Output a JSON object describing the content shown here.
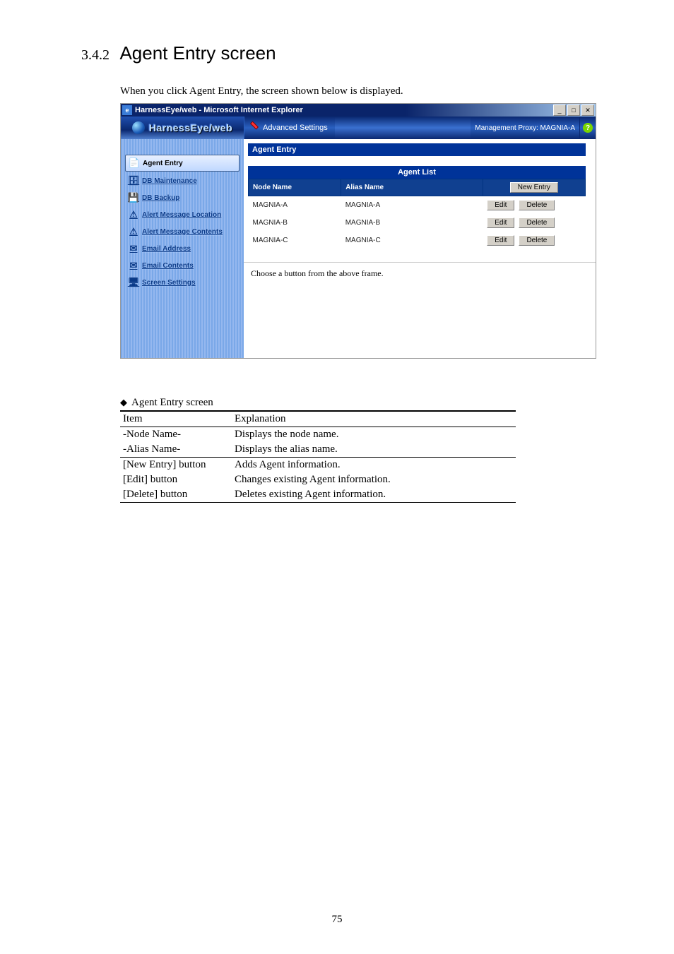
{
  "heading": {
    "number": "3.4.2",
    "title": "Agent Entry screen"
  },
  "intro": "When you click Agent Entry, the screen shown below is displayed.",
  "window": {
    "title": "HarnessEye/web - Microsoft Internet Explorer",
    "brand": "HarnessEye/web",
    "menu_advanced": "Advanced Settings",
    "mgmt_proxy": "Management Proxy: MAGNIA-A",
    "help": "?"
  },
  "sidebar": {
    "items": [
      {
        "label": "Agent Entry",
        "active": true,
        "icon": "📄"
      },
      {
        "label": "DB Maintenance",
        "active": false,
        "icon": "🗄"
      },
      {
        "label": "DB Backup",
        "active": false,
        "icon": "💾"
      },
      {
        "label": "Alert Message Location",
        "active": false,
        "icon": "⚠"
      },
      {
        "label": "Alert Message Contents",
        "active": false,
        "icon": "⚠"
      },
      {
        "label": "Email Address",
        "active": false,
        "icon": "✉"
      },
      {
        "label": "Email Contents",
        "active": false,
        "icon": "✉"
      },
      {
        "label": "Screen Settings",
        "active": false,
        "icon": "🖥"
      }
    ]
  },
  "panel": {
    "title": "Agent Entry",
    "list_title": "Agent List",
    "columns": {
      "node": "Node Name",
      "alias": "Alias Name"
    },
    "new_entry_label": "New Entry",
    "edit_label": "Edit",
    "delete_label": "Delete",
    "rows": [
      {
        "node": "MAGNIA-A",
        "alias": "MAGNIA-A"
      },
      {
        "node": "MAGNIA-B",
        "alias": "MAGNIA-B"
      },
      {
        "node": "MAGNIA-C",
        "alias": "MAGNIA-C"
      }
    ],
    "footer_hint": "Choose a button from the above frame."
  },
  "explain": {
    "caption": "Agent Entry screen",
    "header": {
      "item": "Item",
      "explanation": "Explanation"
    },
    "rows": [
      {
        "item": "-Node Name-",
        "explanation": "Displays the node name."
      },
      {
        "item": "-Alias Name-",
        "explanation": "Displays the alias name."
      },
      {
        "item": "[New Entry] button",
        "explanation": "Adds Agent information."
      },
      {
        "item": "[Edit] button",
        "explanation": "Changes existing Agent information."
      },
      {
        "item": "[Delete] button",
        "explanation": "Deletes existing Agent information."
      }
    ]
  },
  "page_number": "75"
}
